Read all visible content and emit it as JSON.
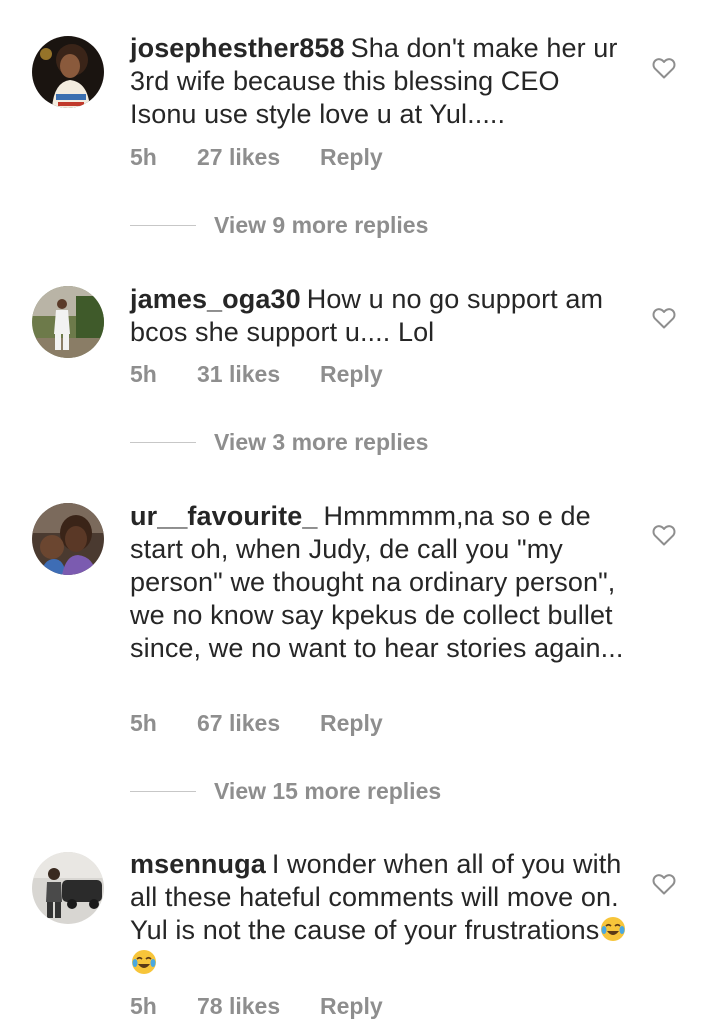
{
  "comments": [
    {
      "username": "josephesther858",
      "text": "Sha don't make her ur 3rd wife because this blessing CEO Isonu use style love u at Yul.....",
      "time": "5h",
      "likes": "27 likes",
      "reply": "Reply",
      "view_replies": "View 9 more replies"
    },
    {
      "username": "james_oga30",
      "text": "How u no go support am bcos she support u.... Lol",
      "time": "5h",
      "likes": "31 likes",
      "reply": "Reply",
      "view_replies": "View 3 more replies"
    },
    {
      "username": "ur__favourite_",
      "text": "Hmmmmm,na so e de start oh, when Judy, de call you \"my person\" we thought na ordinary person\", we no know say kpekus de collect bullet since,  we no want to hear stories again...",
      "time": "5h",
      "likes": "67 likes",
      "reply": "Reply",
      "view_replies": "View 15 more replies"
    },
    {
      "username": "msennuga",
      "text": "I wonder when all of you with all these hateful comments will move on. Yul is not the cause of your frustrations",
      "emoji": "face-with-tears-of-joy x2",
      "time": "5h",
      "likes": "78 likes",
      "reply": "Reply"
    }
  ],
  "icons": {
    "like": "heart-outline-icon",
    "emoji": "face-with-tears-of-joy-icon"
  },
  "colors": {
    "text": "#262626",
    "meta": "#8e8e8e",
    "divider": "#c7c7c7",
    "background": "#ffffff"
  }
}
